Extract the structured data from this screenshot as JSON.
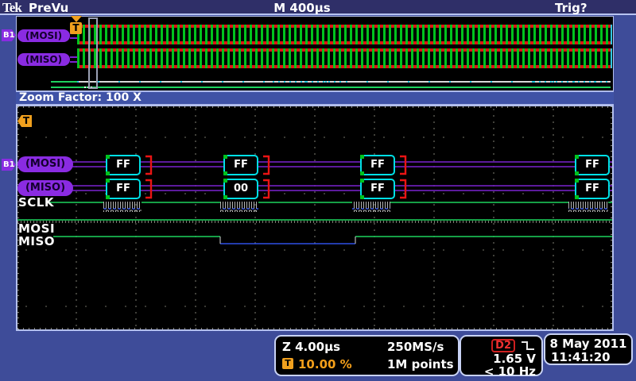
{
  "header": {
    "logo": "Tek",
    "acq_status": "PreVu",
    "timebase": "M 400µs",
    "trigger_status": "Trig?"
  },
  "zoom_factor_label": "Zoom Factor: 100 X",
  "bus": {
    "badge": "B1",
    "mosi_label": "(MOSI)",
    "miso_label": "(MISO)"
  },
  "digital": {
    "sclk": "SCLK",
    "mosi": "MOSI",
    "miso": "MISO"
  },
  "decode": {
    "mosi_bytes": [
      "FF",
      "FF",
      "FF",
      "FF"
    ],
    "miso_bytes": [
      "FF",
      "00",
      "FF",
      "FF"
    ]
  },
  "trigger": {
    "marker": "T"
  },
  "readouts": {
    "zoom_timebase": "Z 4.00µs",
    "sample_rate": "250MS/s",
    "trigger_position": "10.00 %",
    "record_length": "1M points",
    "trigger_source": "D2",
    "trigger_level": "1.65 V",
    "trigger_frequency": "< 10 Hz",
    "date": "8 May 2011",
    "time": "11:41:20"
  }
}
